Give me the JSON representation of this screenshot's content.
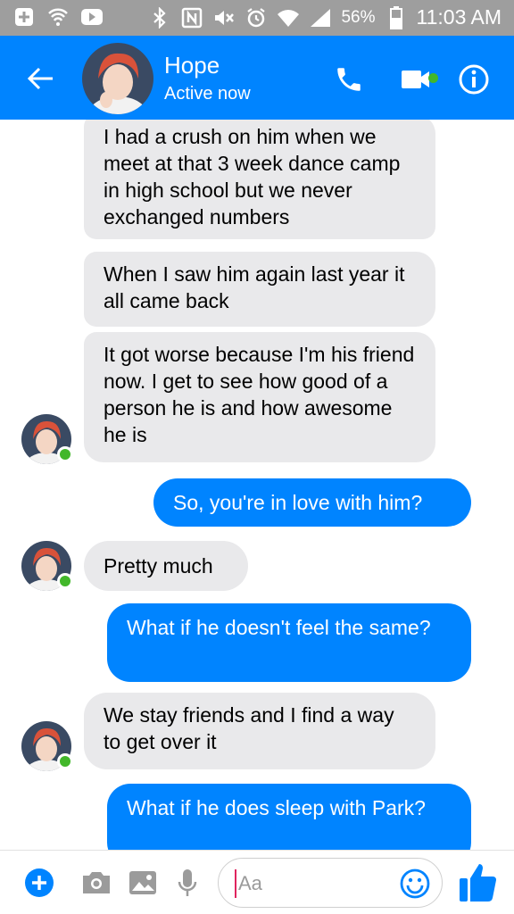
{
  "status_bar": {
    "battery": "56%",
    "time": "11:03 AM",
    "icons": [
      "add-icon",
      "wifi-call-icon",
      "youtube-icon",
      "bluetooth-icon",
      "nfc-icon",
      "mute-icon",
      "alarm-icon",
      "wifi-icon",
      "signal-icon",
      "battery-icon"
    ]
  },
  "header": {
    "contact_name": "Hope",
    "status": "Active now"
  },
  "messages": [
    {
      "type": "received",
      "text": "I had a crush on him when we meet at that 3 week dance camp in high school but we never exchanged numbers"
    },
    {
      "type": "received",
      "text": "When I saw him again last year it all came back"
    },
    {
      "type": "received",
      "text": "It got worse because I'm his friend now. I get to see how good of a person he is and how awesome he is"
    },
    {
      "type": "sent",
      "text": "So, you're in love with him?"
    },
    {
      "type": "received",
      "text": "Pretty much"
    },
    {
      "type": "sent",
      "text": "What if he doesn't feel the same?"
    },
    {
      "type": "received",
      "text": "We stay friends and I find a way to get over it"
    },
    {
      "type": "sent",
      "text": "What if he does sleep with Park?"
    }
  ],
  "composer": {
    "placeholder": "Aa"
  },
  "colors": {
    "messenger_blue": "#0084ff",
    "status_bar_gray": "#9e9e9e",
    "received_bubble": "#e9e9eb",
    "online_green": "#42b72a"
  }
}
